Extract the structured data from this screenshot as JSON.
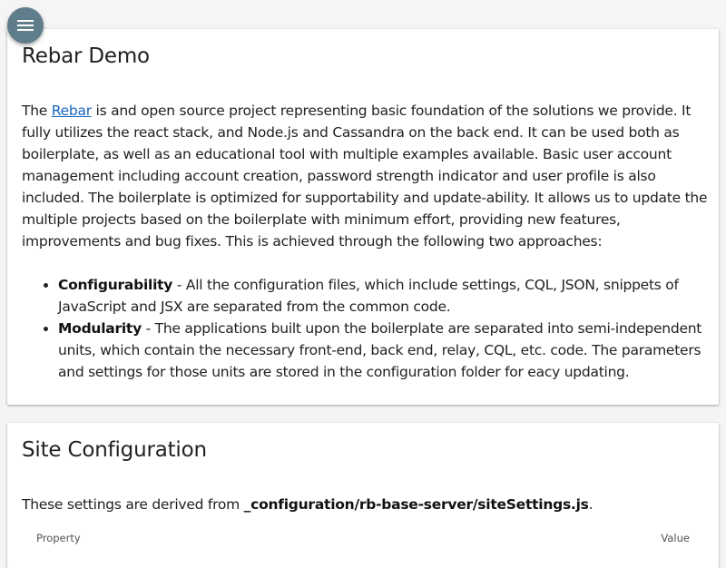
{
  "fab": {
    "icon": "menu-icon"
  },
  "rebar": {
    "title": "Rebar Demo",
    "intro_prefix": "The ",
    "link_text": "Rebar",
    "intro_rest": " is and open source project representing basic foundation of the solutions we provide. It fully utilizes the react stack, and Node.js and Cassandra on the back end. It can be used both as boilerplate, as well as an educational tool with multiple examples available. Basic user account management including account creation, password strength indicator and user profile is also included. The boilerplate is optimized for supportability and update-ability. It allows us to update the multiple projects based on the boilerplate with minimum effort, providing new features, improvements and bug fixes. This is achieved through the following two approaches:",
    "features": [
      {
        "name": "Configurability",
        "desc": " - All the configuration files, which include settings, CQL, JSON, snippets of JavaScript and JSX are separated from the common code."
      },
      {
        "name": "Modularity",
        "desc": " - The applications built upon the boilerplate are separated into semi-independent units, which contain the necessary front-end, back end, relay, CQL, etc. code. The parameters and settings for those units are stored in the configuration folder for eacy updating."
      }
    ]
  },
  "site_config": {
    "title": "Site Configuration",
    "derived_prefix": "These settings are derived from ",
    "derived_path": "_configuration/rb-base-server/siteSettings.js",
    "derived_suffix": ".",
    "table": {
      "col_property": "Property",
      "col_value": "Value"
    }
  },
  "colors": {
    "background": "#f5f5f5",
    "fab": "#607d8b",
    "link": "#1565c0",
    "card": "#ffffff"
  }
}
